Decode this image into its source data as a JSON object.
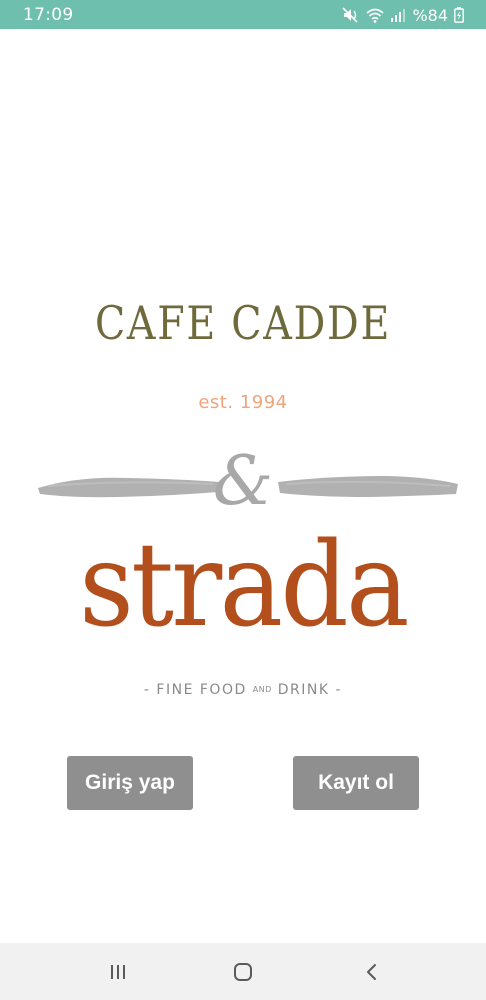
{
  "status_bar": {
    "time": "17:09",
    "battery_text": "%84",
    "icons": [
      "mute-icon",
      "wifi-icon",
      "signal-icon",
      "battery-charging-icon"
    ],
    "background": "#6fbfae"
  },
  "logo": {
    "brand_top": "CAFE CADDE",
    "est": "est. 1994",
    "ampersand": "&",
    "brand_main": "strada",
    "tagline_part1": "- FINE FOOD ",
    "tagline_small": "AND",
    "tagline_part2": " DRINK -",
    "colors": {
      "top": "#6f6a3c",
      "est": "#f0a47a",
      "main": "#b24f1c",
      "grey": "#a8a8a8"
    }
  },
  "actions": {
    "login_label": "Giriş yap",
    "register_label": "Kayıt ol",
    "button_color": "#8f8f8f"
  },
  "nav_bar": {
    "icons": [
      "recent-apps-icon",
      "home-icon",
      "back-icon"
    ]
  }
}
